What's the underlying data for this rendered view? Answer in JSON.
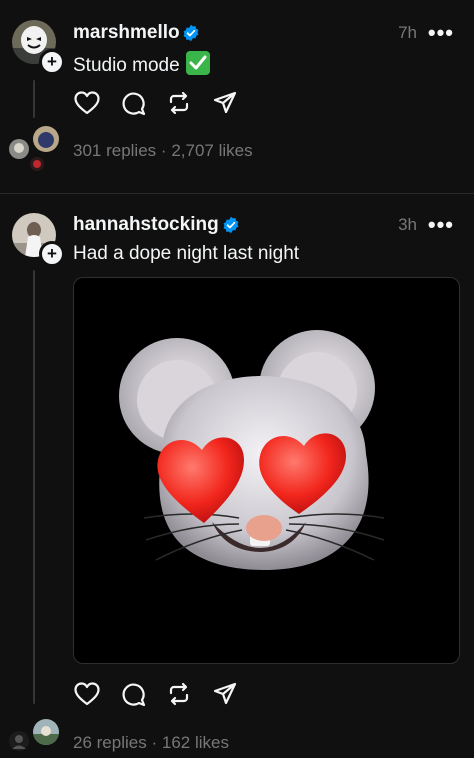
{
  "posts": [
    {
      "username": "marshmello",
      "time": "7h",
      "more": "•••",
      "text": "Studio mode",
      "replies": "301 replies",
      "separator": "·",
      "likes": "2,707 likes"
    },
    {
      "username": "hannahstocking",
      "time": "3h",
      "more": "•••",
      "text": "Had a dope night last night",
      "replies": "26 replies",
      "separator": "·",
      "likes": "162 likes"
    }
  ],
  "icons": [
    "heart-icon",
    "comment-icon",
    "repost-icon",
    "share-icon",
    "verified-badge-icon",
    "follow-plus-icon",
    "check-emoji-icon"
  ],
  "colors": {
    "background": "#101010",
    "text": "#f3f5f7",
    "muted": "#777777",
    "verified": "#0095f6",
    "check": "#39b54a"
  }
}
